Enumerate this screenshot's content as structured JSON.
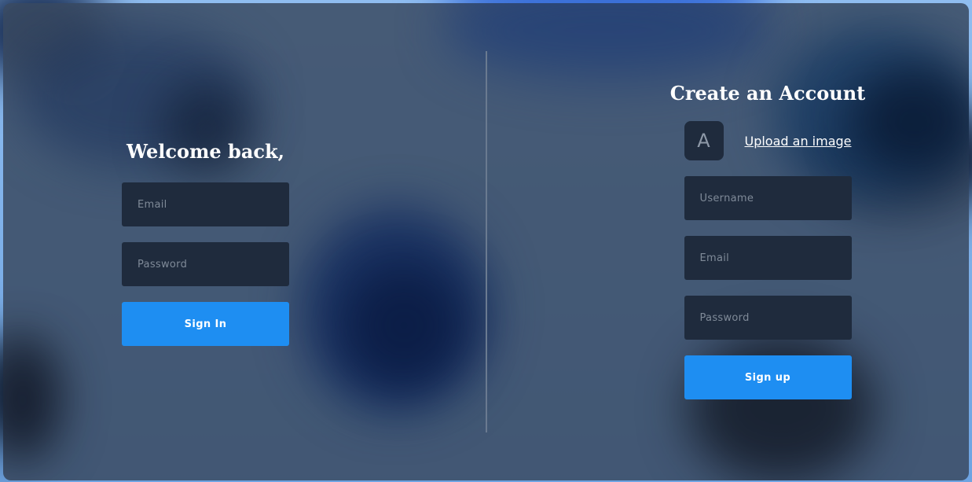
{
  "login": {
    "title": "Welcome back,",
    "email_placeholder": "Email",
    "password_placeholder": "Password",
    "submit_label": "Sign In"
  },
  "signup": {
    "title": "Create an Account",
    "avatar_letter": "A",
    "upload_label": "Upload an image",
    "username_placeholder": "Username",
    "email_placeholder": "Email",
    "password_placeholder": "Password",
    "submit_label": "Sign up"
  },
  "colors": {
    "accent": "#1e8ef2",
    "card": "#3a4a62",
    "field": "#1f2b3d"
  }
}
